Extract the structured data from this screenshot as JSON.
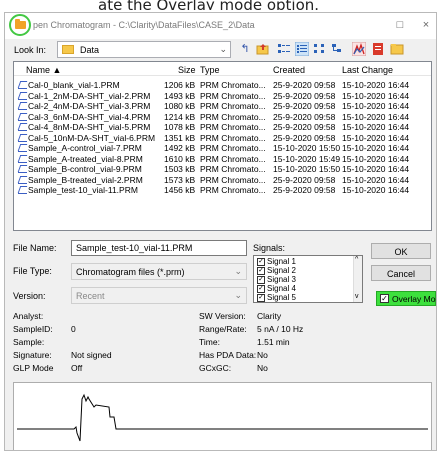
{
  "caption": {
    "text": "ate the Overlay mode option."
  },
  "window": {
    "title": "pen Chromatogram - C:\\Clarity\\DataFiles\\CASE_2\\Data",
    "maximize_icon": "□",
    "close_icon": "×"
  },
  "toolbar": {
    "look_in_label": "Look In:",
    "look_in_value": "Data",
    "icons": [
      "back-icon",
      "up-folder-icon",
      "list-view-icon",
      "details-view-icon",
      "tiles-view-icon",
      "tree-view-icon",
      "chart-icon",
      "red-document-icon",
      "folder-icon"
    ]
  },
  "file_list": {
    "columns": {
      "name": "Name ▲",
      "size": "Size",
      "type": "Type",
      "created": "Created",
      "last_change": "Last Change"
    },
    "rows": [
      {
        "name": "Cal-0_blank_vial-1.PRM",
        "size": "1206 kB",
        "type": "PRM Chromato...",
        "created": "25-9-2020 09:58",
        "last_change": "15-10-2020 16:44"
      },
      {
        "name": "Cal-1_2nM-DA-SHT_vial-2.PRM",
        "size": "1493 kB",
        "type": "PRM Chromato...",
        "created": "25-9-2020 09:58",
        "last_change": "15-10-2020 16:44"
      },
      {
        "name": "Cal-2_4nM-DA-SHT_vial-3.PRM",
        "size": "1080 kB",
        "type": "PRM Chromato...",
        "created": "25-9-2020 09:58",
        "last_change": "15-10-2020 16:44"
      },
      {
        "name": "Cal-3_6nM-DA-SHT_vial-4.PRM",
        "size": "1214 kB",
        "type": "PRM Chromato...",
        "created": "25-9-2020 09:58",
        "last_change": "15-10-2020 16:44"
      },
      {
        "name": "Cal-4_8nM-DA-SHT_vial-5.PRM",
        "size": "1078 kB",
        "type": "PRM Chromato...",
        "created": "25-9-2020 09:58",
        "last_change": "15-10-2020 16:44"
      },
      {
        "name": "Cal-5_10nM-DA-SHT_vial-6.PRM",
        "size": "1351 kB",
        "type": "PRM Chromato...",
        "created": "25-9-2020 09:58",
        "last_change": "15-10-2020 16:44"
      },
      {
        "name": "Sample_A-control_vial-7.PRM",
        "size": "1492 kB",
        "type": "PRM Chromato...",
        "created": "15-10-2020 15:50",
        "last_change": "15-10-2020 16:44"
      },
      {
        "name": "Sample_A-treated_vial-8.PRM",
        "size": "1610 kB",
        "type": "PRM Chromato...",
        "created": "15-10-2020 15:49",
        "last_change": "15-10-2020 16:44"
      },
      {
        "name": "Sample_B-control_vial-9.PRM",
        "size": "1503 kB",
        "type": "PRM Chromato...",
        "created": "15-10-2020 15:50",
        "last_change": "15-10-2020 16:44"
      },
      {
        "name": "Sample_B-treated_vial-2.PRM",
        "size": "1573 kB",
        "type": "PRM Chromato...",
        "created": "25-9-2020 09:58",
        "last_change": "15-10-2020 16:44"
      },
      {
        "name": "Sample_test-10_vial-11.PRM",
        "size": "1456 kB",
        "type": "PRM Chromato...",
        "created": "25-9-2020 09:58",
        "last_change": "15-10-2020 16:44"
      }
    ]
  },
  "form": {
    "file_name_label": "File Name:",
    "file_name_value": "Sample_test-10_vial-11.PRM",
    "file_type_label": "File Type:",
    "file_type_value": "Chromatogram files (*.prm)",
    "version_label": "Version:",
    "version_value": "Recent",
    "signals_label": "Signals:",
    "signals": [
      "Signal 1",
      "Signal 2",
      "Signal 3",
      "Signal 4",
      "Signal 5"
    ],
    "ok_label": "OK",
    "cancel_label": "Cancel",
    "overlay_label": "Overlay Mode",
    "overlay_checked": "✓"
  },
  "details": {
    "analyst_label": "Analyst:",
    "analyst_value": "",
    "sampleid_label": "SampleID:",
    "sampleid_value": "0",
    "sample_label": "Sample:",
    "sample_value": "",
    "signature_label": "Signature:",
    "signature_value": "Not signed",
    "glp_label": "GLP Mode",
    "glp_value": "Off",
    "sw_label": "SW Version:",
    "sw_value": "Clarity",
    "range_label": "Range/Rate:",
    "range_value": "5 nA / 10 Hz",
    "time_label": "Time:",
    "time_value": "1.51 min",
    "pda_label": "Has PDA Data:",
    "pda_value": "No",
    "gcxgc_label": "GCxGC:",
    "gcxgc_value": "No"
  },
  "colors": {
    "overlay_highlight": "#3de03d",
    "title_icon_ring": "#43c843",
    "folder": "#f2a227",
    "trace": "#000000"
  }
}
